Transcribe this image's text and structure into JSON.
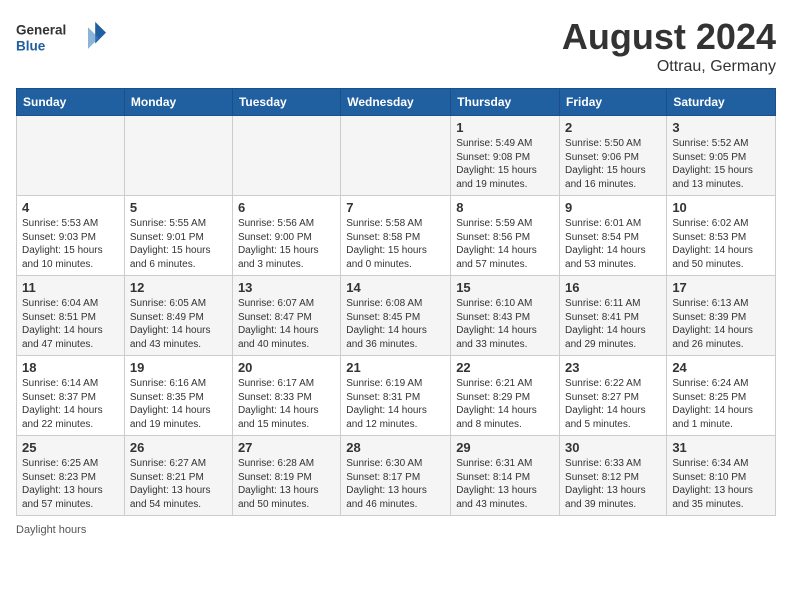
{
  "header": {
    "logo_general": "General",
    "logo_blue": "Blue",
    "month_year": "August 2024",
    "location": "Ottrau, Germany"
  },
  "days_of_week": [
    "Sunday",
    "Monday",
    "Tuesday",
    "Wednesday",
    "Thursday",
    "Friday",
    "Saturday"
  ],
  "weeks": [
    [
      {
        "day": "",
        "info": ""
      },
      {
        "day": "",
        "info": ""
      },
      {
        "day": "",
        "info": ""
      },
      {
        "day": "",
        "info": ""
      },
      {
        "day": "1",
        "info": "Sunrise: 5:49 AM\nSunset: 9:08 PM\nDaylight: 15 hours\nand 19 minutes."
      },
      {
        "day": "2",
        "info": "Sunrise: 5:50 AM\nSunset: 9:06 PM\nDaylight: 15 hours\nand 16 minutes."
      },
      {
        "day": "3",
        "info": "Sunrise: 5:52 AM\nSunset: 9:05 PM\nDaylight: 15 hours\nand 13 minutes."
      }
    ],
    [
      {
        "day": "4",
        "info": "Sunrise: 5:53 AM\nSunset: 9:03 PM\nDaylight: 15 hours\nand 10 minutes."
      },
      {
        "day": "5",
        "info": "Sunrise: 5:55 AM\nSunset: 9:01 PM\nDaylight: 15 hours\nand 6 minutes."
      },
      {
        "day": "6",
        "info": "Sunrise: 5:56 AM\nSunset: 9:00 PM\nDaylight: 15 hours\nand 3 minutes."
      },
      {
        "day": "7",
        "info": "Sunrise: 5:58 AM\nSunset: 8:58 PM\nDaylight: 15 hours\nand 0 minutes."
      },
      {
        "day": "8",
        "info": "Sunrise: 5:59 AM\nSunset: 8:56 PM\nDaylight: 14 hours\nand 57 minutes."
      },
      {
        "day": "9",
        "info": "Sunrise: 6:01 AM\nSunset: 8:54 PM\nDaylight: 14 hours\nand 53 minutes."
      },
      {
        "day": "10",
        "info": "Sunrise: 6:02 AM\nSunset: 8:53 PM\nDaylight: 14 hours\nand 50 minutes."
      }
    ],
    [
      {
        "day": "11",
        "info": "Sunrise: 6:04 AM\nSunset: 8:51 PM\nDaylight: 14 hours\nand 47 minutes."
      },
      {
        "day": "12",
        "info": "Sunrise: 6:05 AM\nSunset: 8:49 PM\nDaylight: 14 hours\nand 43 minutes."
      },
      {
        "day": "13",
        "info": "Sunrise: 6:07 AM\nSunset: 8:47 PM\nDaylight: 14 hours\nand 40 minutes."
      },
      {
        "day": "14",
        "info": "Sunrise: 6:08 AM\nSunset: 8:45 PM\nDaylight: 14 hours\nand 36 minutes."
      },
      {
        "day": "15",
        "info": "Sunrise: 6:10 AM\nSunset: 8:43 PM\nDaylight: 14 hours\nand 33 minutes."
      },
      {
        "day": "16",
        "info": "Sunrise: 6:11 AM\nSunset: 8:41 PM\nDaylight: 14 hours\nand 29 minutes."
      },
      {
        "day": "17",
        "info": "Sunrise: 6:13 AM\nSunset: 8:39 PM\nDaylight: 14 hours\nand 26 minutes."
      }
    ],
    [
      {
        "day": "18",
        "info": "Sunrise: 6:14 AM\nSunset: 8:37 PM\nDaylight: 14 hours\nand 22 minutes."
      },
      {
        "day": "19",
        "info": "Sunrise: 6:16 AM\nSunset: 8:35 PM\nDaylight: 14 hours\nand 19 minutes."
      },
      {
        "day": "20",
        "info": "Sunrise: 6:17 AM\nSunset: 8:33 PM\nDaylight: 14 hours\nand 15 minutes."
      },
      {
        "day": "21",
        "info": "Sunrise: 6:19 AM\nSunset: 8:31 PM\nDaylight: 14 hours\nand 12 minutes."
      },
      {
        "day": "22",
        "info": "Sunrise: 6:21 AM\nSunset: 8:29 PM\nDaylight: 14 hours\nand 8 minutes."
      },
      {
        "day": "23",
        "info": "Sunrise: 6:22 AM\nSunset: 8:27 PM\nDaylight: 14 hours\nand 5 minutes."
      },
      {
        "day": "24",
        "info": "Sunrise: 6:24 AM\nSunset: 8:25 PM\nDaylight: 14 hours\nand 1 minute."
      }
    ],
    [
      {
        "day": "25",
        "info": "Sunrise: 6:25 AM\nSunset: 8:23 PM\nDaylight: 13 hours\nand 57 minutes."
      },
      {
        "day": "26",
        "info": "Sunrise: 6:27 AM\nSunset: 8:21 PM\nDaylight: 13 hours\nand 54 minutes."
      },
      {
        "day": "27",
        "info": "Sunrise: 6:28 AM\nSunset: 8:19 PM\nDaylight: 13 hours\nand 50 minutes."
      },
      {
        "day": "28",
        "info": "Sunrise: 6:30 AM\nSunset: 8:17 PM\nDaylight: 13 hours\nand 46 minutes."
      },
      {
        "day": "29",
        "info": "Sunrise: 6:31 AM\nSunset: 8:14 PM\nDaylight: 13 hours\nand 43 minutes."
      },
      {
        "day": "30",
        "info": "Sunrise: 6:33 AM\nSunset: 8:12 PM\nDaylight: 13 hours\nand 39 minutes."
      },
      {
        "day": "31",
        "info": "Sunrise: 6:34 AM\nSunset: 8:10 PM\nDaylight: 13 hours\nand 35 minutes."
      }
    ]
  ],
  "footer": {
    "note": "Daylight hours"
  }
}
